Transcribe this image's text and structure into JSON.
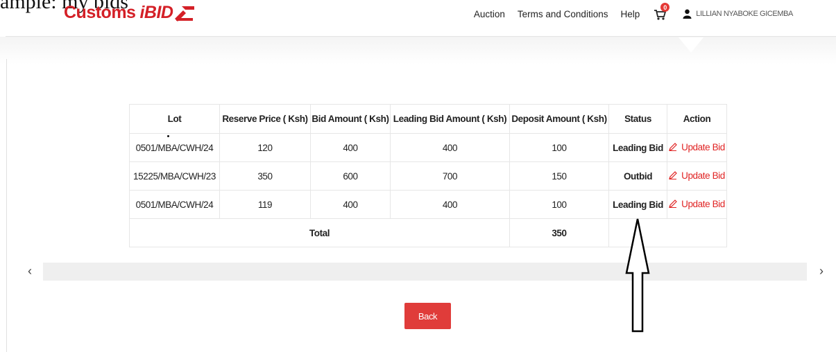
{
  "header": {
    "top_clip_text": "ample: my bids",
    "logo_text": "Customs",
    "logo_ibid": "iBID",
    "nav": [
      "Auction",
      "Terms and Conditions",
      "Help"
    ],
    "cart_count": "0",
    "user_name": "LILLIAN NYABOKE GICEMBA"
  },
  "table": {
    "headers": [
      "Lot",
      "Reserve Price ( Ksh)",
      "Bid Amount ( Ksh)",
      "Leading Bid Amount ( Ksh)",
      "Deposit Amount ( Ksh)",
      "Status",
      "Action"
    ],
    "rows": [
      {
        "lot": "0501/MBA/CWH/24",
        "reserve": "120",
        "bid": "400",
        "leading": "400",
        "deposit": "100",
        "status": "Leading Bid",
        "action": "Update Bid"
      },
      {
        "lot": "15225/MBA/CWH/23",
        "reserve": "350",
        "bid": "600",
        "leading": "700",
        "deposit": "150",
        "status": "Outbid",
        "action": "Update Bid"
      },
      {
        "lot": "0501/MBA/CWH/24",
        "reserve": "119",
        "bid": "400",
        "leading": "400",
        "deposit": "100",
        "status": "Leading Bid",
        "action": "Update Bid"
      }
    ],
    "total_label": "Total",
    "total_value": "350"
  },
  "scroll": {
    "left_glyph": "‹",
    "right_glyph": "›"
  },
  "back_label": "Back",
  "colors": {
    "brand": "#d42027",
    "leading": "#1f8a2e",
    "outbid": "#e02424",
    "button": "#e03c3a"
  }
}
